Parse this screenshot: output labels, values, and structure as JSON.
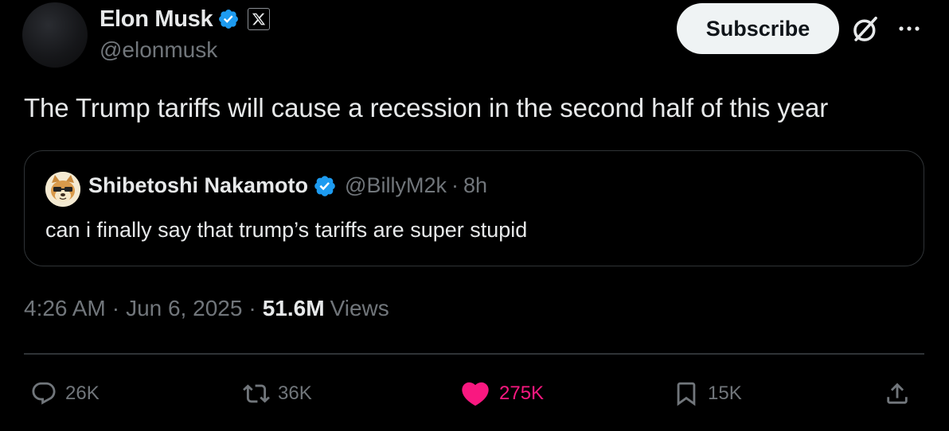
{
  "author": {
    "name": "Elon Musk",
    "handle": "@elonmusk",
    "avatar_icon": "avatar"
  },
  "header": {
    "subscribe_label": "Subscribe",
    "grok_icon": "grok-icon",
    "more_icon": "more-icon"
  },
  "tweet": {
    "text": "The Trump tariffs will cause a recession in the second half of this year"
  },
  "quote": {
    "name": "Shibetoshi Nakamoto",
    "handle": "@BillyM2k",
    "separator": "·",
    "time": "8h",
    "text": "can i finally say that trump’s tariffs are super stupid"
  },
  "meta": {
    "time": "4:26 AM",
    "separator": "·",
    "date": "Jun 6, 2025",
    "views_count": "51.6M",
    "views_label": "Views"
  },
  "actions": {
    "replies": "26K",
    "reposts": "36K",
    "likes": "275K",
    "bookmarks": "15K"
  },
  "colors": {
    "background": "#000000",
    "text": "#e7e9ea",
    "muted": "#71767b",
    "verified": "#1d9bf0",
    "like": "#f91880",
    "border": "#2f3336"
  }
}
